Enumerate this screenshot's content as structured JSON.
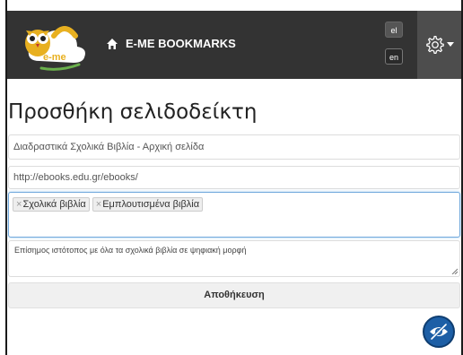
{
  "navbar": {
    "logo_text": "e-me",
    "brand_label": "E-ME BOOKMARKS",
    "languages": [
      "el",
      "en"
    ],
    "brand_color": "#333333"
  },
  "page": {
    "title": "Προσθήκη σελιδοδείκτη"
  },
  "form": {
    "title_value": "Διαδραστικά Σχολικά Βιβλία - Αρχική σελίδα",
    "url_value": "http://ebooks.edu.gr/ebooks/",
    "tags": [
      "Σχολικά βιβλία",
      "Εμπλουτισμένα βιβλία"
    ],
    "tag_remove_glyph": "×",
    "description_value": "Επίσημος ιστότοπος με όλα τα σχολικά βιβλία σε ψηφιακή μορφή",
    "save_label": "Αποθήκευση"
  },
  "icons": {
    "home": "home-icon",
    "settings": "gear-icon",
    "accessibility": "eye-slash-icon"
  },
  "colors": {
    "accent": "#1d5fa6",
    "focus_border": "#6fa8dc"
  }
}
